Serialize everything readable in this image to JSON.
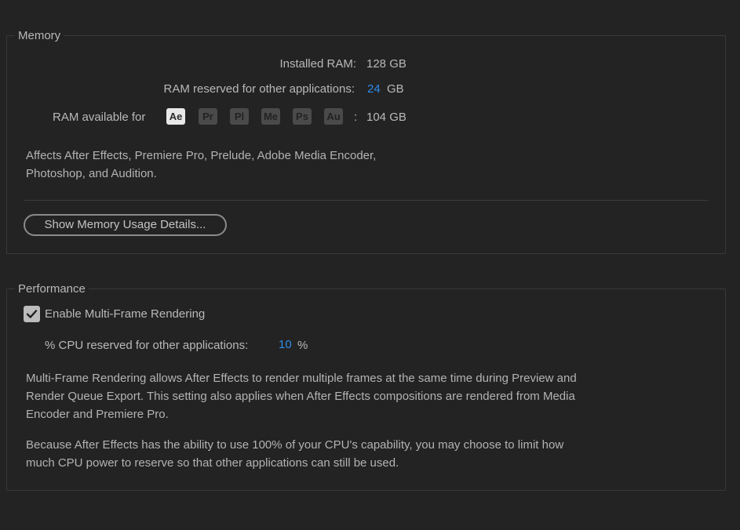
{
  "memory": {
    "title": "Memory",
    "installed_label": "Installed RAM:",
    "installed_value": "128 GB",
    "reserved_label": "RAM reserved for other applications:",
    "reserved_value": "24",
    "reserved_unit": "GB",
    "available_label": "RAM available for",
    "apps": [
      "Ae",
      "Pr",
      "Pl",
      "Me",
      "Ps",
      "Au"
    ],
    "available_sep": ":",
    "available_value": "104 GB",
    "affects_line1": "Affects After Effects, Premiere Pro, Prelude, Adobe Media Encoder,",
    "affects_line2": "Photoshop, and Audition.",
    "details_button": "Show Memory Usage Details..."
  },
  "performance": {
    "title": "Performance",
    "mfr_label": "Enable Multi-Frame Rendering",
    "mfr_checked": true,
    "cpu_label": "% CPU reserved for other applications:",
    "cpu_value": "10",
    "cpu_unit": "%",
    "desc1_line1": "Multi-Frame Rendering allows After Effects to render multiple frames at the same time during Preview and",
    "desc1_line2": "Render Queue Export. This setting also applies when After Effects compositions are rendered from Media",
    "desc1_line3": "Encoder and Premiere Pro.",
    "desc2_line1": "Because After Effects has the ability to use 100% of your CPU's capability, you may choose to limit how",
    "desc2_line2": "much CPU power to reserve so that other applications can still be used."
  },
  "colors": {
    "background": "#232323",
    "accent_value": "#2d8ceb",
    "text": "#b9b9b9"
  }
}
